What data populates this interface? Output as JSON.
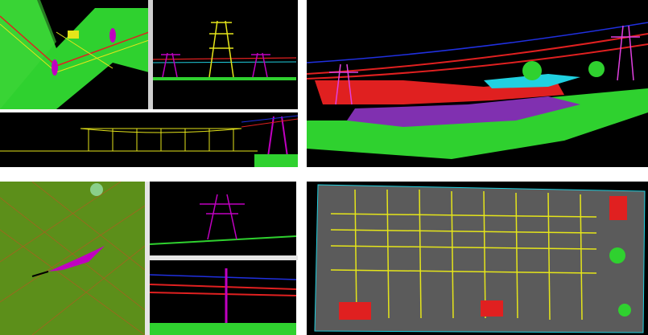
{
  "layout_name": "power-line-pointcloud-collage",
  "panels": [
    {
      "id": "tl",
      "kind": "quad-split-view",
      "subviews": [
        "top-view",
        "tower-profile-view",
        "substation-profile-view"
      ]
    },
    {
      "id": "tr",
      "kind": "perspective-view"
    },
    {
      "id": "bl",
      "kind": "quad-split-view",
      "subviews": [
        "top-view",
        "tower-front-view",
        "tower-side-view"
      ]
    },
    {
      "id": "br",
      "kind": "substation-plan-view"
    }
  ],
  "colors": {
    "ground": "#2fd12f",
    "vegetation": "#49e13e",
    "tower_magenta": "#c000c0",
    "tower_yellow": "#e5e51a",
    "conductor_red": "#e02020",
    "conductor_blue": "#2030e0",
    "conductor_cyan": "#20d0e0",
    "background_black": "#000000",
    "plan_gray": "#5b5b5b"
  }
}
